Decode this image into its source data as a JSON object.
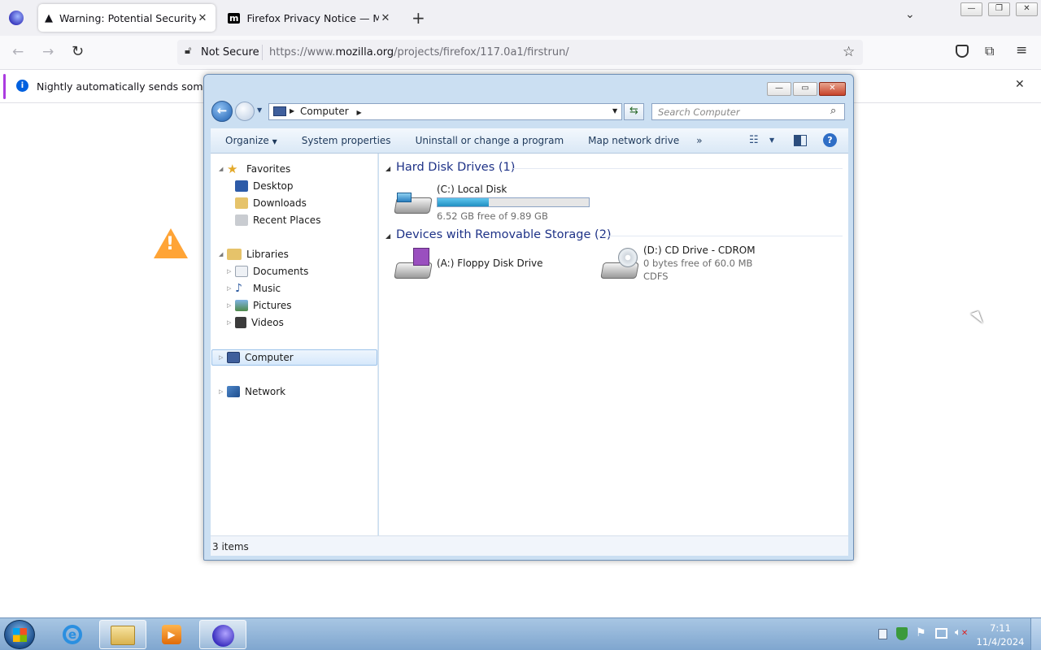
{
  "browser": {
    "tabs": [
      {
        "title": "Warning: Potential Security Risk Ahead",
        "icon": "warning-icon"
      },
      {
        "title": "Firefox Privacy Notice — Mozilla",
        "icon": "mozilla-m-icon"
      }
    ],
    "security_label": "Not Secure",
    "url_prefix": "https://www.",
    "url_domain": "mozilla.org",
    "url_path": "/projects/firefox/117.0a1/firstrun/",
    "notice_text": "Nightly automatically sends some data to Mozilla so that we can improve your experience."
  },
  "explorer": {
    "breadcrumb": "Computer",
    "search_placeholder": "Search Computer",
    "toolbar": {
      "organize": "Organize",
      "system_properties": "System properties",
      "uninstall": "Uninstall or change a program",
      "map_drive": "Map network drive",
      "more": "»"
    },
    "nav": {
      "favorites": "Favorites",
      "desktop": "Desktop",
      "downloads": "Downloads",
      "recent": "Recent Places",
      "libraries": "Libraries",
      "documents": "Documents",
      "music": "Music",
      "pictures": "Pictures",
      "videos": "Videos",
      "computer": "Computer",
      "network": "Network"
    },
    "groups": {
      "hdd": "Hard Disk Drives (1)",
      "removable": "Devices with Removable Storage (2)"
    },
    "drives": {
      "c_name": "(C:) Local Disk",
      "c_free": "6.52 GB free of 9.89 GB",
      "c_used_fraction": 0.34,
      "a_name": "(A:) Floppy Disk Drive",
      "d_name": "(D:) CD Drive - CDROM",
      "d_free": "0 bytes free of 60.0 MB",
      "d_fs": "CDFS"
    },
    "status": "3 items"
  },
  "taskbar": {
    "time": "7:11",
    "date": "11/4/2024"
  }
}
